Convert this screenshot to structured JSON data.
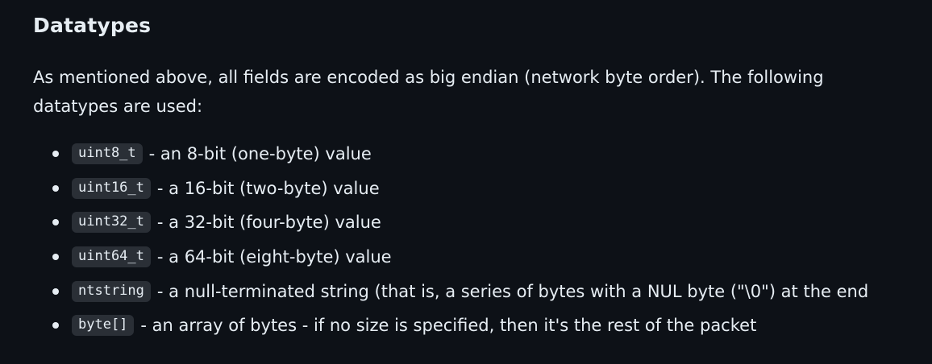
{
  "heading": "Datatypes",
  "intro": "As mentioned above, all fields are encoded as big endian (network byte order). The following datatypes are used:",
  "items": [
    {
      "code": "uint8_t",
      "desc": "- an 8-bit (one-byte) value"
    },
    {
      "code": "uint16_t",
      "desc": "- a 16-bit (two-byte) value"
    },
    {
      "code": "uint32_t",
      "desc": "- a 32-bit (four-byte) value"
    },
    {
      "code": "uint64_t",
      "desc": "- a 64-bit (eight-byte) value"
    },
    {
      "code": "ntstring",
      "desc": "- a null-terminated string (that is, a series of bytes with a NUL byte (\"\\0\") at the end"
    },
    {
      "code": "byte[]",
      "desc": "- an array of bytes - if no size is specified, then it's the rest of the packet"
    }
  ],
  "colors": {
    "background": "#0d1117",
    "text": "#e6edf3",
    "code_background": "#2a2f36"
  }
}
